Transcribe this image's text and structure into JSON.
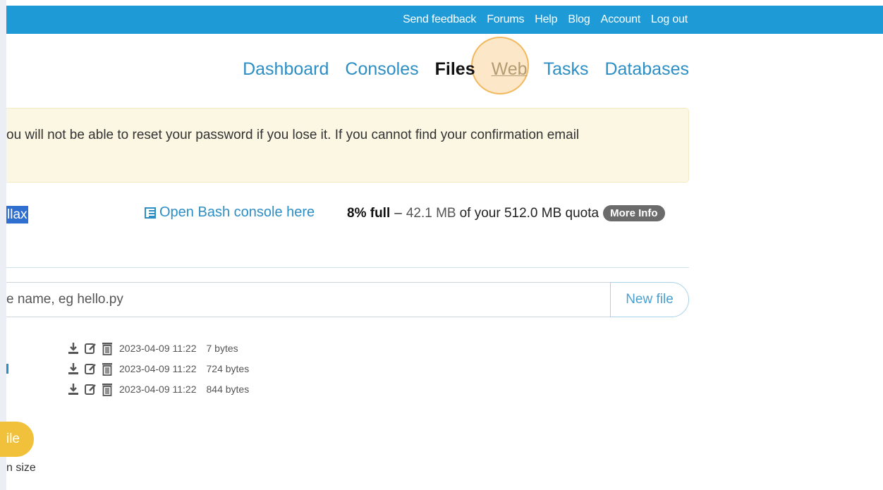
{
  "topbar": {
    "links": [
      "Send feedback",
      "Forums",
      "Help",
      "Blog",
      "Account",
      "Log out"
    ],
    "color": "#1e9bd7"
  },
  "nav": {
    "items": [
      "Dashboard",
      "Consoles",
      "Files",
      "Web",
      "Tasks",
      "Databases"
    ],
    "active": "Files",
    "highlighted": "Web"
  },
  "warning": {
    "text": "ou will not be able to reset your password if you lose it. If you cannot find your confirmation email"
  },
  "path": {
    "selected_text": "llax"
  },
  "bash_link": {
    "label": "Open Bash console here",
    "icon": "console-icon"
  },
  "quota": {
    "percent_label": "8% full",
    "dash": "–",
    "used": "42.1 MB",
    "of_text": "of your 512.0 MB quota",
    "more_info": "More Info"
  },
  "new_file": {
    "placeholder": "e name, eg hello.py",
    "button": "New file"
  },
  "files": [
    {
      "modified": "2023-04-09 11:22",
      "size": "7 bytes"
    },
    {
      "modified": "2023-04-09 11:22",
      "size": "724 bytes"
    },
    {
      "modified": "2023-04-09 11:22",
      "size": "844 bytes"
    }
  ],
  "upload": {
    "label": "ile",
    "note": "n size"
  }
}
